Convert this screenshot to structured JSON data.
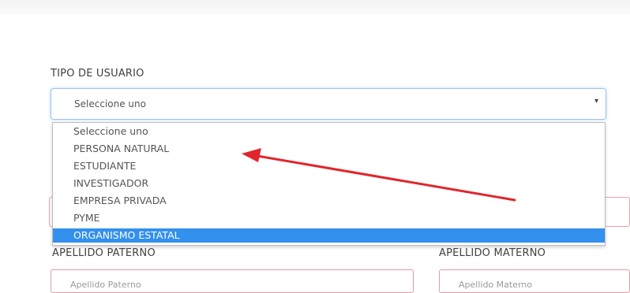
{
  "form": {
    "tipo_label": "TIPO DE USUARIO",
    "select_value": "Seleccione uno",
    "caret": "▾",
    "options": [
      "Seleccione uno",
      "PERSONA NATURAL",
      "ESTUDIANTE",
      "INVESTIGADOR",
      "EMPRESA PRIVADA",
      "PYME",
      "ORGANISMO ESTATAL"
    ],
    "highlighted_option": "ORGANISMO ESTATAL",
    "apellido_paterno_label": "APELLIDO PATERNO",
    "apellido_materno_label": "APELLIDO MATERNO",
    "apellido_paterno_placeholder": "Apellido Paterno",
    "apellido_materno_placeholder": "Apellido Materno"
  },
  "colors": {
    "highlight": "#3390ec",
    "annotation_arrow": "#e0262c",
    "input_border": "#e29aa6"
  }
}
